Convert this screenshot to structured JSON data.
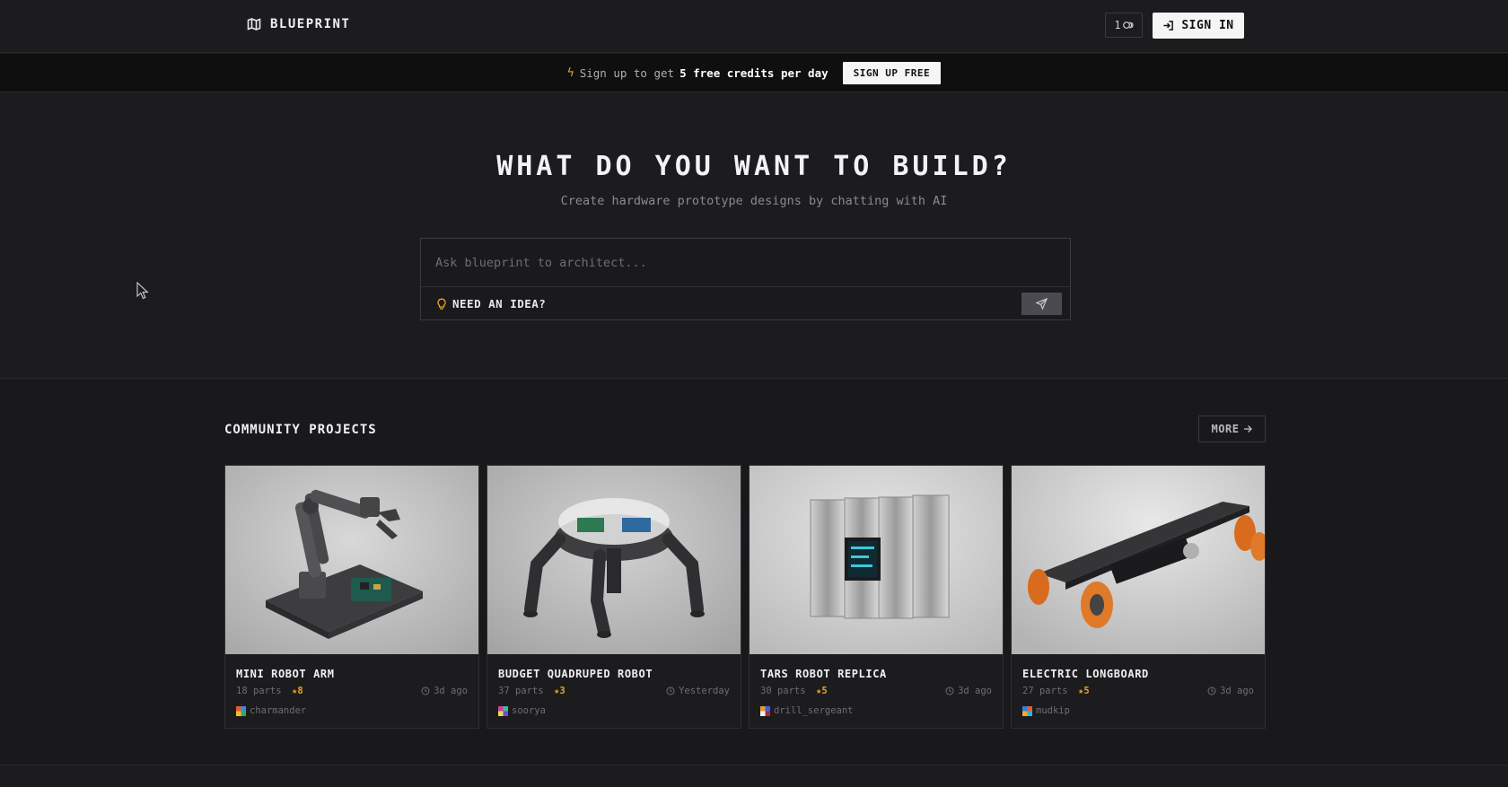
{
  "header": {
    "logo_text": "BLUEPRINT",
    "credits_count": "1",
    "signin_label": "SIGN IN"
  },
  "banner": {
    "text_before": "Sign up to get",
    "text_strong": "5 free credits per day",
    "button_label": "SIGN UP FREE"
  },
  "hero": {
    "title": "WHAT DO YOU WANT TO BUILD?",
    "subtitle": "Create hardware prototype designs by chatting with AI",
    "input_placeholder": "Ask blueprint to architect...",
    "idea_label": "NEED AN IDEA?"
  },
  "community": {
    "title": "COMMUNITY PROJECTS",
    "more_label": "MORE",
    "projects": [
      {
        "title": "MINI ROBOT ARM",
        "parts": "18 parts",
        "stars": "8",
        "time": "3d ago",
        "user": "charmander",
        "avatar_colors": [
          "#e85a2a",
          "#3a8be0",
          "#f0c020",
          "#2ab05a"
        ]
      },
      {
        "title": "BUDGET QUADRUPED ROBOT",
        "parts": "37 parts",
        "stars": "3",
        "time": "Yesterday",
        "user": "soorya",
        "avatar_colors": [
          "#d040a0",
          "#30c0a0",
          "#e0e040",
          "#8040e0"
        ]
      },
      {
        "title": "TARS ROBOT REPLICA",
        "parts": "30 parts",
        "stars": "5",
        "time": "3d ago",
        "user": "drill_sergeant",
        "avatar_colors": [
          "#e0a030",
          "#4060e0",
          "#f0f0f0",
          "#a03040"
        ]
      },
      {
        "title": "ELECTRIC LONGBOARD",
        "parts": "27 parts",
        "stars": "5",
        "time": "3d ago",
        "user": "mudkip",
        "avatar_colors": [
          "#3080e0",
          "#e06030",
          "#f0b020",
          "#30b0e0"
        ]
      }
    ]
  }
}
